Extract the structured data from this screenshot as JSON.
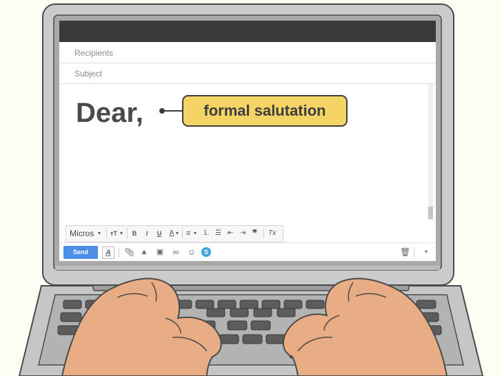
{
  "email": {
    "recipients_placeholder": "Recipients",
    "subject_placeholder": "Subject",
    "body_text": "Dear,"
  },
  "callout": {
    "label": "formal salutation"
  },
  "format_toolbar": {
    "font_select": "Micros",
    "size_icon": "text-size-icon",
    "bold": "B",
    "italic": "I",
    "underline": "U",
    "text_color": "A",
    "remove_format": "Tx"
  },
  "bottom_toolbar": {
    "send_label": "Send",
    "format_toggle": "A"
  },
  "colors": {
    "callout_bg": "#f5d466",
    "send_button": "#4d8fe6",
    "screen_topbar": "#3a3a3a",
    "laptop_frame": "#c7c7c7",
    "skin": "#e8ad84"
  }
}
